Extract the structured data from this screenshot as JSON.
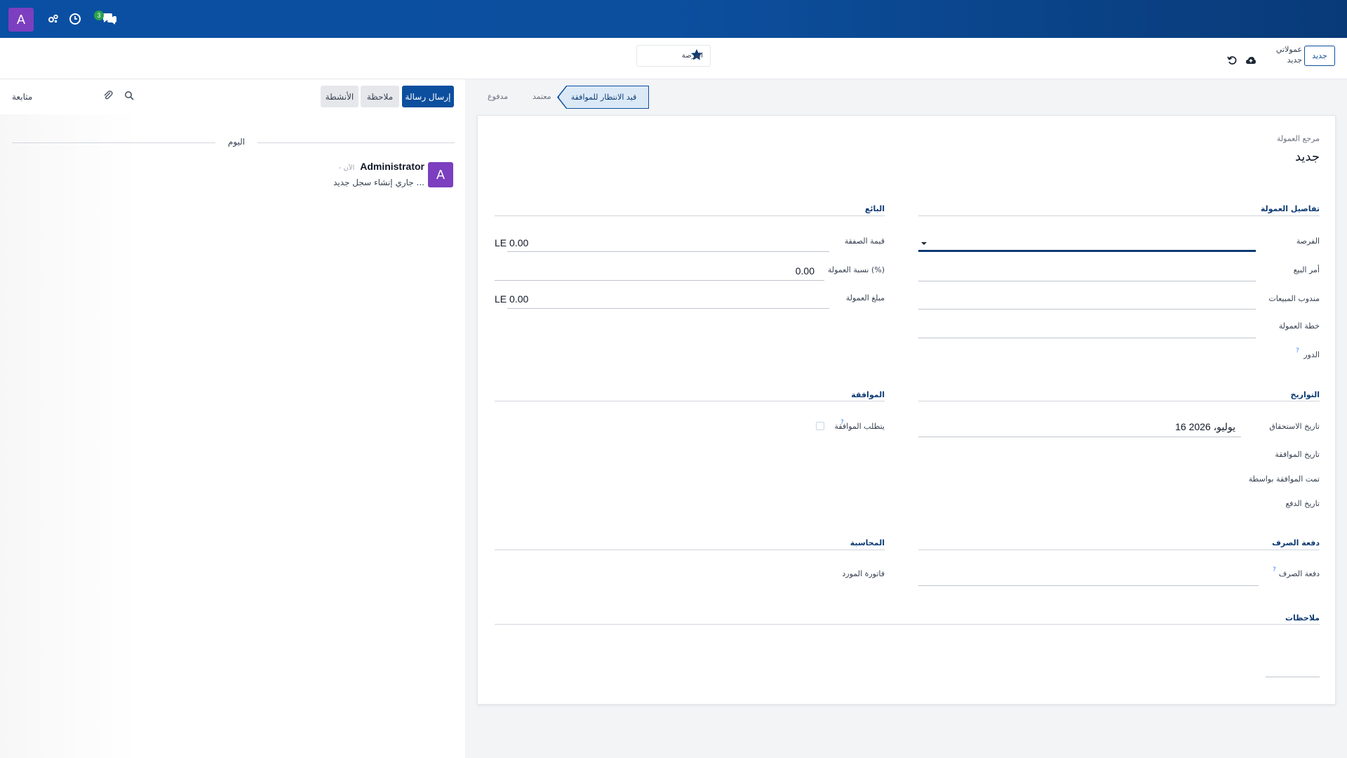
{
  "navbar": {
    "avatar_letter": "A",
    "badge_count": "3",
    "icons": [
      "user-avatar",
      "gear-group-icon",
      "clock-icon",
      "chat-icon"
    ]
  },
  "control_panel": {
    "new_button": "جديد",
    "breadcrumb_parent": "عمولاتي",
    "breadcrumb_current": "جديد",
    "smart_button_label": "الفرصة"
  },
  "chatter": {
    "follow": "متابعة",
    "send_message": "إرسال رسالة",
    "log_note": "ملاحظة",
    "activities": "الأنشطة",
    "today": "اليوم",
    "message": {
      "avatar_letter": "A",
      "author": "Administrator",
      "time": "- الآن",
      "body": "جاري إنشاء سجل جديد ..."
    }
  },
  "statusbar": {
    "active_stage": "قيد الانتظار للموافقة",
    "stage_approved": "معتمد",
    "stage_paid": "مدفوع"
  },
  "form": {
    "reference_label": "مرجع العمولة",
    "reference_value": "جديد",
    "commission_details": {
      "title": "تفاصيل العمولة",
      "opportunity_label": "الفرصة",
      "sale_order_label": "أمر البيع",
      "salesperson_label": "مندوب المبيعات",
      "plan_label": "خطة العمولة",
      "role_label": "الدور"
    },
    "seller": {
      "title": "البائع",
      "deal_value_label": "قيمة الصفقة",
      "deal_value": "LE 0.00",
      "rate_label": "نسبة العمولة (%)",
      "rate_value": "0.00",
      "amount_label": "مبلغ العمولة",
      "amount_value": "LE 0.00"
    },
    "dates": {
      "title": "التواريخ",
      "due_date_label": "تاريخ الاستحقاق",
      "due_date_value": "16 يوليو، 2026",
      "approval_date_label": "تاريخ الموافقة",
      "approved_by_label": "تمت الموافقة بواسطة",
      "payment_date_label": "تاريخ الدفع"
    },
    "approval": {
      "title": "الموافقة",
      "requires_approval_label": "يتطلب الموافقة"
    },
    "payout": {
      "title": "دفعة الصرف",
      "payout_label": "دفعة الصرف"
    },
    "accounting": {
      "title": "المحاسبة",
      "vendor_bill_label": "فاتورة المورد"
    },
    "notes": {
      "title": "ملاحظات"
    },
    "help_mark": "?"
  },
  "colors": {
    "navbar": "#0c4f9e",
    "primary": "#0c4f9e",
    "avatar": "#7b3fbf",
    "badge": "#2aa14a"
  }
}
